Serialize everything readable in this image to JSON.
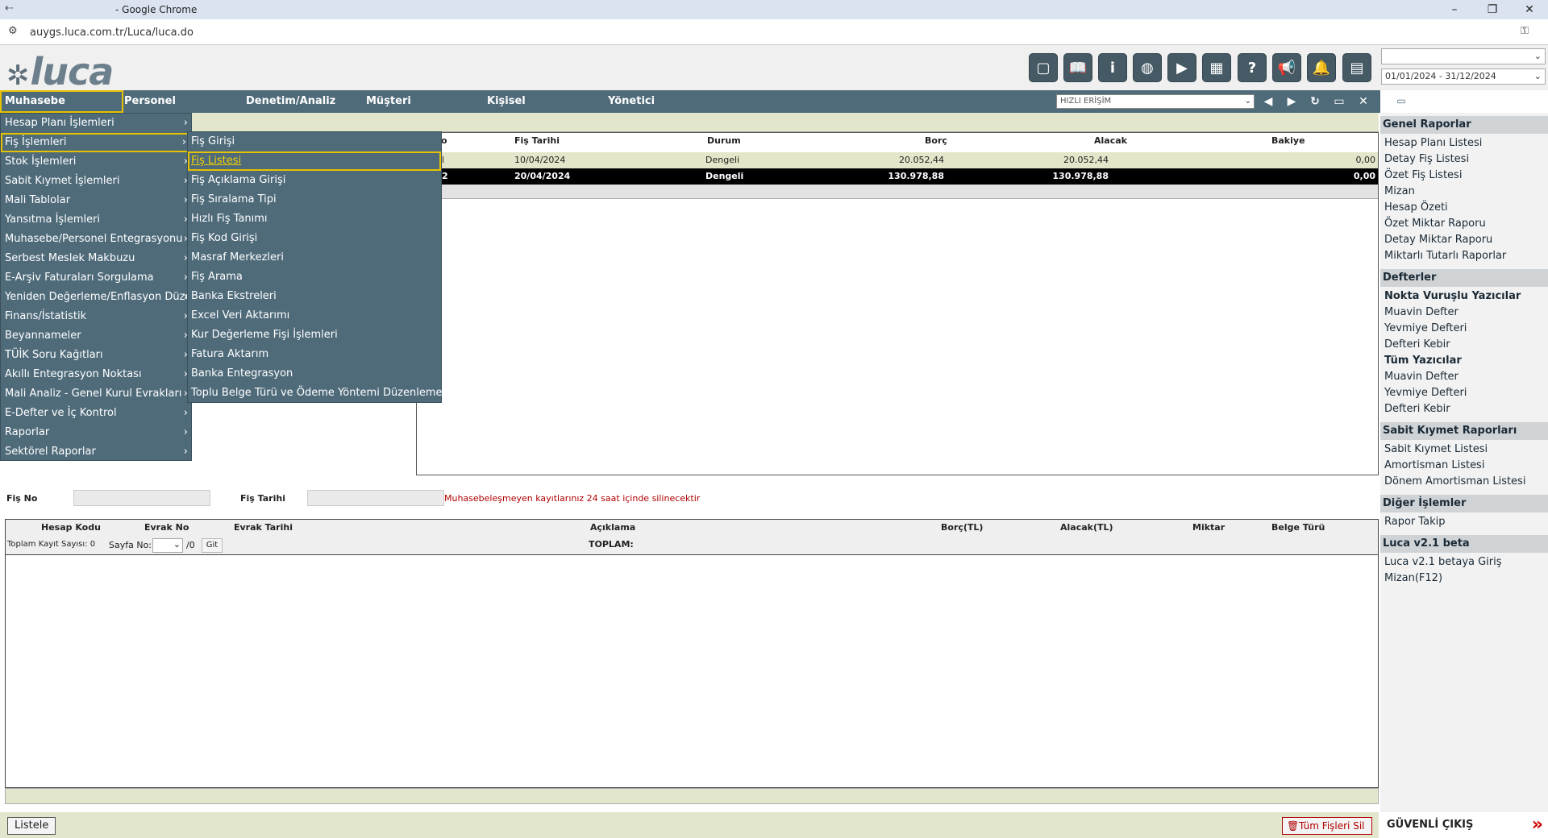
{
  "browser": {
    "title": "- Google Chrome",
    "url": "auygs.luca.com.tr/Luca/luca.do"
  },
  "header": {
    "logo": "luca",
    "toolbar_icons": [
      "notepad-icon",
      "book-icon",
      "info-icon",
      "globe-icon",
      "youtube-icon",
      "calculator-icon",
      "help-icon",
      "megaphone-icon",
      "bell-icon",
      "ledger-icon"
    ],
    "company_select": "",
    "period_select": "01/01/2024 - 31/12/2024"
  },
  "nav": {
    "items": [
      "Muhasebe",
      "Personel",
      "Denetim/Analiz",
      "Müşteri",
      "Kişisel",
      "Yönetici"
    ],
    "quick_access": "HIZLI ERİŞİM"
  },
  "menu1": [
    {
      "label": "Hesap Planı İşlemleri",
      "arrow": true
    },
    {
      "label": "Fiş İşlemleri",
      "arrow": true
    },
    {
      "label": "Stok İşlemleri",
      "arrow": true
    },
    {
      "label": "Sabit Kıymet İşlemleri",
      "arrow": true
    },
    {
      "label": "Mali Tablolar",
      "arrow": true
    },
    {
      "label": "Yansıtma İşlemleri",
      "arrow": true
    },
    {
      "label": "Muhasebe/Personel Entegrasyonu",
      "arrow": true
    },
    {
      "label": "Serbest Meslek Makbuzu",
      "arrow": true
    },
    {
      "label": "E-Arşiv Faturaları Sorgulama",
      "arrow": true
    },
    {
      "label": "Yeniden Değerleme/Enflasyon Düzeltme",
      "arrow": true
    },
    {
      "label": "Finans/İstatistik",
      "arrow": true
    },
    {
      "label": "Beyannameler",
      "arrow": true
    },
    {
      "label": "TÜİK Soru Kağıtları",
      "arrow": true
    },
    {
      "label": "Akıllı Entegrasyon Noktası",
      "arrow": true
    },
    {
      "label": "Mali Analiz - Genel Kurul Evrakları",
      "arrow": true
    },
    {
      "label": "E-Defter ve İç Kontrol",
      "arrow": true
    },
    {
      "label": "Raporlar",
      "arrow": true
    },
    {
      "label": "Sektörel Raporlar",
      "arrow": true
    }
  ],
  "menu2": [
    "Fiş Girişi",
    "Fiş Listesi",
    "Fiş Açıklama Girişi",
    "Fiş Sıralama Tipi",
    "Hızlı Fiş Tanımı",
    "Fiş Kod Girişi",
    "Masraf Merkezleri",
    "Fiş Arama",
    "Banka Ekstreleri",
    "Excel Veri Aktarımı",
    "Kur Değerleme Fişi İşlemleri",
    "Fatura Aktarım",
    "Banka Entegrasyon",
    "Toplu Belge Türü ve Ödeme Yöntemi Düzenleme"
  ],
  "grid": {
    "columns": [
      "o",
      "Fiş Tarihi",
      "Durum",
      "Borç",
      "Alacak",
      "Bakiye"
    ],
    "rows": [
      {
        "no": "l",
        "date": "10/04/2024",
        "status": "Dengeli",
        "borc": "20.052,44",
        "alacak": "20.052,44",
        "bakiye": "0,00"
      },
      {
        "no": "2",
        "date": "20/04/2024",
        "status": "Dengeli",
        "borc": "130.978,88",
        "alacak": "130.978,88",
        "bakiye": "0,00"
      }
    ]
  },
  "fis_form": {
    "fis_no_label": "Fiş No",
    "fis_tarihi_label": "Fiş Tarihi",
    "warning": "Muhasebeleşmeyen kayıtlarınız 24 saat içinde silinecektir"
  },
  "detail_grid": {
    "columns": [
      "Hesap Kodu",
      "Evrak No",
      "Evrak Tarihi",
      "Açıklama",
      "Borç(TL)",
      "Alacak(TL)",
      "Miktar",
      "Belge Türü"
    ],
    "total_records_label": "Toplam Kayıt Sayısı: 0",
    "page_label": "Sayfa No:",
    "page_total": "/0",
    "go_button": "Git",
    "total_label": "TOPLAM:"
  },
  "buttons": {
    "listele": "Listele",
    "delete_all": "Tüm Fişleri Sil"
  },
  "right_panel": {
    "sections": [
      {
        "title": "Genel Raporlar",
        "links": [
          {
            "t": "Hesap Planı Listesi"
          },
          {
            "t": "Detay Fiş Listesi"
          },
          {
            "t": "Özet Fiş Listesi"
          },
          {
            "t": "Mizan"
          },
          {
            "t": "Hesap Özeti"
          },
          {
            "t": "Özet Miktar Raporu"
          },
          {
            "t": "Detay Miktar Raporu"
          },
          {
            "t": "Miktarlı Tutarlı Raporlar"
          }
        ]
      },
      {
        "title": "Defterler",
        "links": [
          {
            "t": "Nokta Vuruşlu Yazıcılar",
            "b": true
          },
          {
            "t": "Muavin Defter"
          },
          {
            "t": "Yevmiye Defteri"
          },
          {
            "t": "Defteri Kebir"
          },
          {
            "t": "Tüm Yazıcılar",
            "b": true
          },
          {
            "t": "Muavin Defter"
          },
          {
            "t": "Yevmiye Defteri"
          },
          {
            "t": "Defteri Kebir"
          }
        ]
      },
      {
        "title": "Sabit Kıymet Raporları",
        "links": [
          {
            "t": "Sabit Kıymet Listesi"
          },
          {
            "t": "Amortisman Listesi"
          },
          {
            "t": "Dönem Amortisman Listesi"
          }
        ]
      },
      {
        "title": "Diğer İşlemler",
        "links": [
          {
            "t": "Rapor Takip"
          }
        ]
      },
      {
        "title": "Luca v2.1 beta",
        "links": [
          {
            "t": "Luca v2.1 betaya Giriş"
          },
          {
            "t": "Mizan(F12)"
          }
        ]
      }
    ],
    "exit": "GÜVENLİ ÇIKIŞ"
  },
  "colors": {
    "nav": "#4f6b7a",
    "highlight": "#e6c200",
    "warning": "#b00000"
  }
}
